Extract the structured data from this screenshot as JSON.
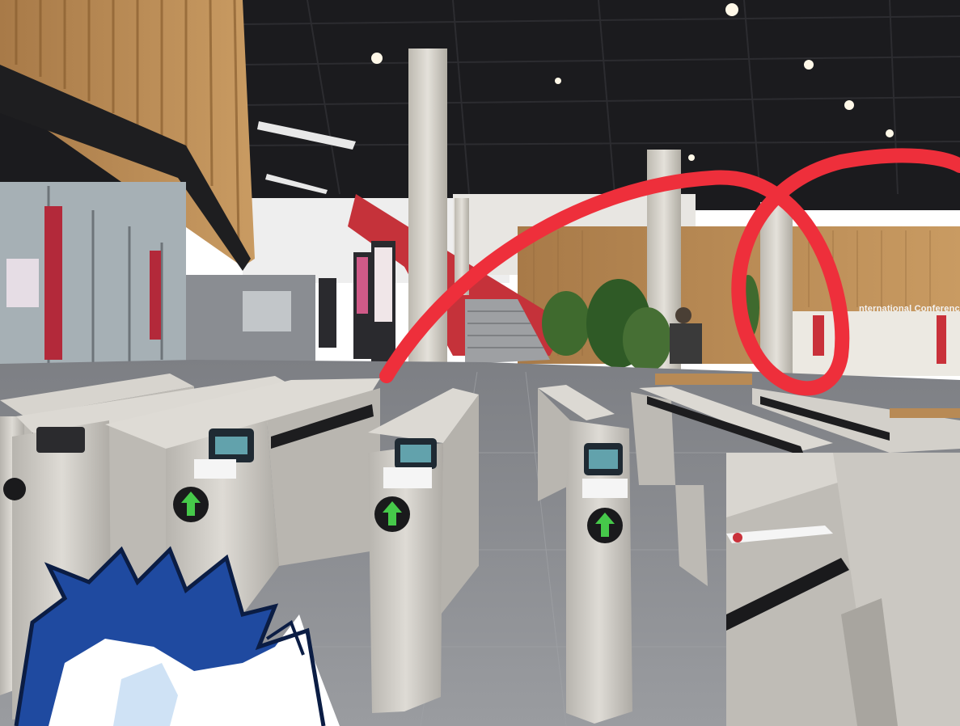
{
  "scene": {
    "signage": {
      "conference_sign": "nternational Conference"
    },
    "colors": {
      "drawn_stroke": "#ee2f3b",
      "wood": "#b88a55",
      "ceiling": "#1b1b1e",
      "floor": "#8c8e93",
      "gate_body": "#c9c6c0",
      "gate_arrow": "#46c94a",
      "mascot_blue": "#1f4aa0"
    },
    "icons": [
      "gate-arrow-icon",
      "contactless-reader-icon"
    ]
  }
}
